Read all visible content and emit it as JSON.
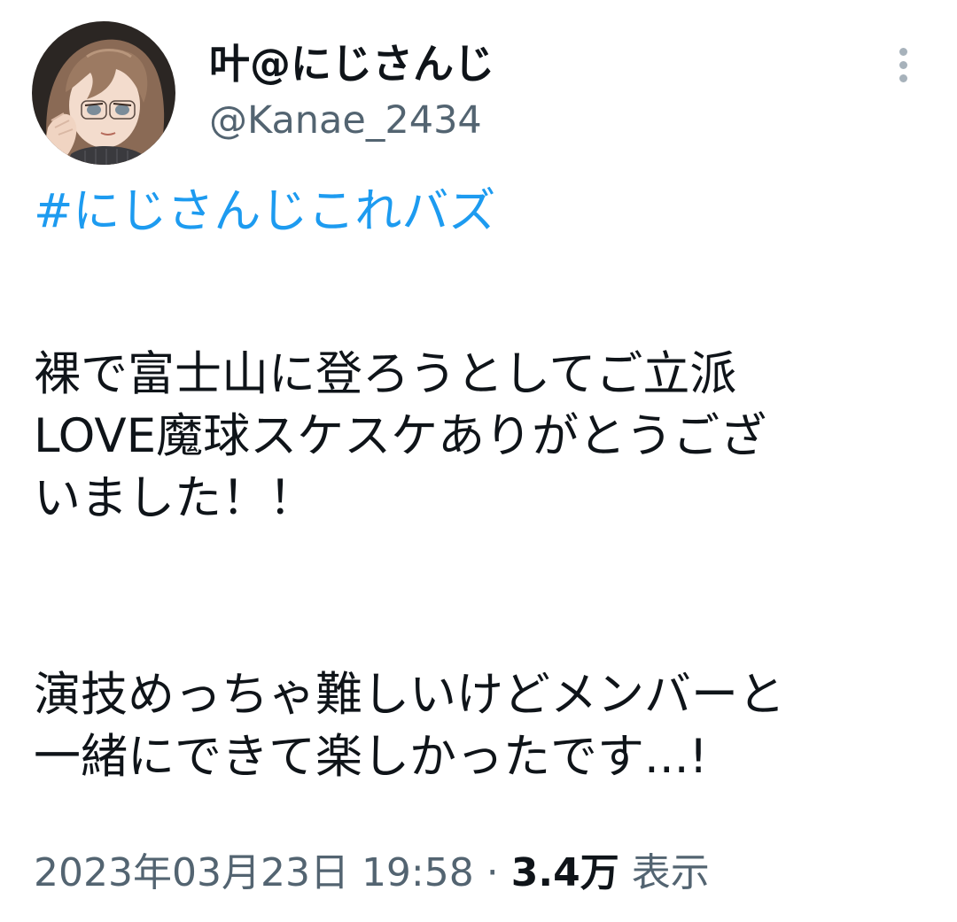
{
  "tweet": {
    "author": {
      "display_name": "叶@にじさんじ",
      "handle": "@Kanae_2434",
      "avatar_icon": "profile-avatar-illustration"
    },
    "menu_icon": "more-options-icon",
    "hashtag": "#にじさんじこれバズ",
    "paragraph_1": "裸で富士山に登ろうとしてご立派\nLOVE魔球スケスケありがとうござ\nいました！！",
    "paragraph_2": "演技めっちゃ難しいけどメンバーと\n一緒にできて楽しかったです...!",
    "timestamp": "2023年03月23日 19:58",
    "separator": "·",
    "views_count": "3.4万",
    "views_label": "表示"
  },
  "colors": {
    "link": "#1d9bf0",
    "text": "#0f1419",
    "secondary": "#536471",
    "menu_dots": "#a7b2bb"
  }
}
